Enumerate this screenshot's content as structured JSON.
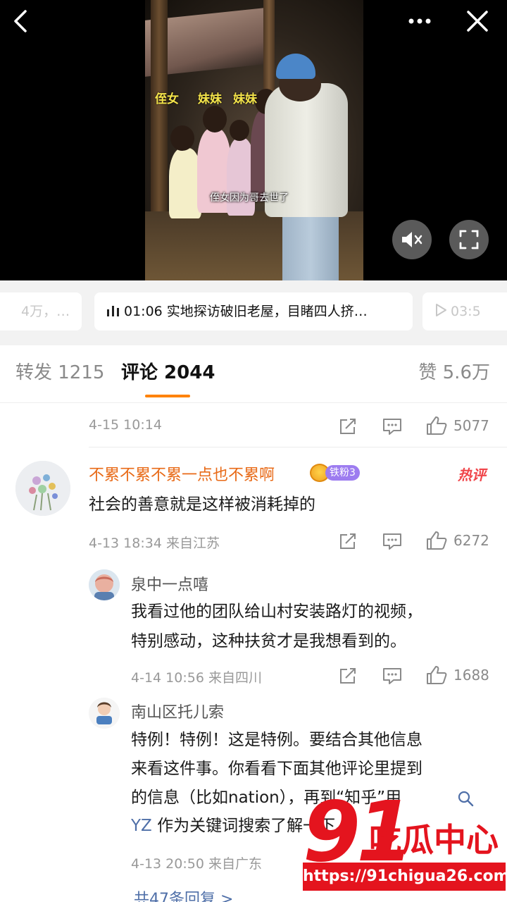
{
  "video": {
    "back_icon": "chevron-left-icon",
    "more_icon": "more-dots-icon",
    "close_icon": "close-icon",
    "overlay_labels": [
      "侄女",
      "妹妹",
      "妹妹"
    ],
    "subtitle": "侄女因为哥去世了",
    "mute_icon": "mute-icon",
    "fullscreen_icon": "fullscreen-icon"
  },
  "chapters": {
    "prev": "4万，…",
    "current": "01:06 实地探访破旧老屋，目睹四人挤…",
    "next": "03:5"
  },
  "tabs": {
    "repost": "转发 1215",
    "comments": "评论 2044",
    "likes": "赞 5.6万"
  },
  "comments": {
    "top_meta": {
      "time": "4-15 10:14",
      "likes": "5077"
    },
    "main": {
      "user": "不累不累不累一点也不累啊",
      "fan_badge": "铁粉3",
      "hot_tag": "热评",
      "text": "社会的善意就是这样被消耗掉的",
      "time": "4-13 18:34 来自江苏",
      "likes": "6272"
    },
    "replies": [
      {
        "user": "泉中一点嘻",
        "lines": [
          "我看过他的团队给山村安装路灯的视频，",
          "特别感动，这种扶贫才是我想看到的。"
        ],
        "time": "4-14 10:56 来自四川",
        "likes": "1688"
      },
      {
        "user": "南山区托儿索",
        "lines": [
          "特例！特例！这是特例。要结合其他信息",
          "来看这件事。你看看下面其他评论里提到",
          "的信息（比如nation），再到“知乎”用",
          "作为关键词搜索了解一下。"
        ],
        "search_link": "YZ",
        "time": "4-13 20:50 来自广东"
      }
    ],
    "more_replies": "共47条回复 >"
  },
  "watermark": {
    "number": "91",
    "name": "吃瓜中心",
    "url": "https://91chigua26.com"
  },
  "colors": {
    "accent": "#ff8200",
    "username_highlight": "#e86a17",
    "link": "#4f6fa8",
    "watermark": "#e4141e"
  }
}
